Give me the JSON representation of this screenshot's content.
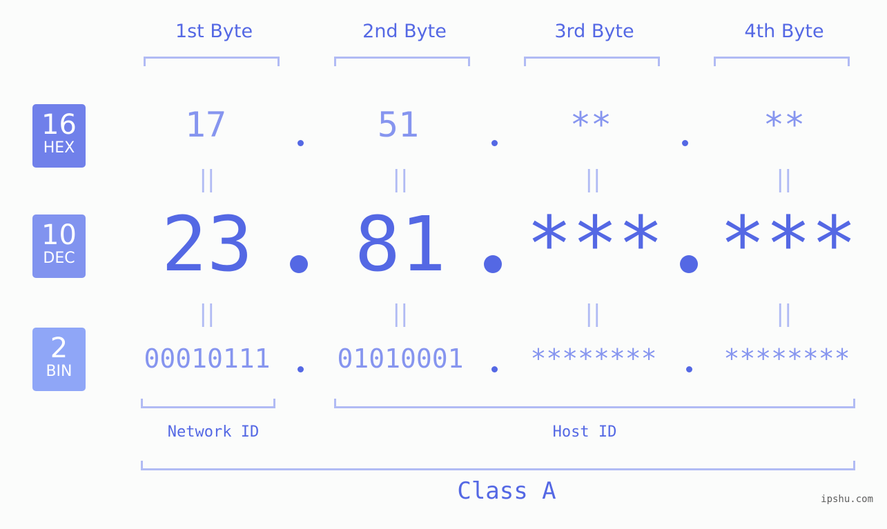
{
  "badges": [
    {
      "num": "16",
      "label": "HEX",
      "color": "#7080ea"
    },
    {
      "num": "10",
      "label": "DEC",
      "color": "#8193ef"
    },
    {
      "num": "2",
      "label": "BIN",
      "color": "#8fa6f7"
    }
  ],
  "bytes": [
    {
      "label": "1st Byte",
      "hex": "17",
      "dec": "23",
      "bin": "00010111"
    },
    {
      "label": "2nd Byte",
      "hex": "51",
      "dec": "81",
      "bin": "01010001"
    },
    {
      "label": "3rd Byte",
      "hex": "**",
      "dec": "***",
      "bin": "********"
    },
    {
      "label": "4th Byte",
      "hex": "**",
      "dec": "***",
      "bin": "********"
    }
  ],
  "equals_symbol": "||",
  "network_id_label": "Network ID",
  "host_id_label": "Host ID",
  "class_label": "Class A",
  "watermark": "ipshu.com",
  "colors": {
    "primary": "#5468e4",
    "light": "#8695ef",
    "bracket": "#b1bbf4"
  }
}
